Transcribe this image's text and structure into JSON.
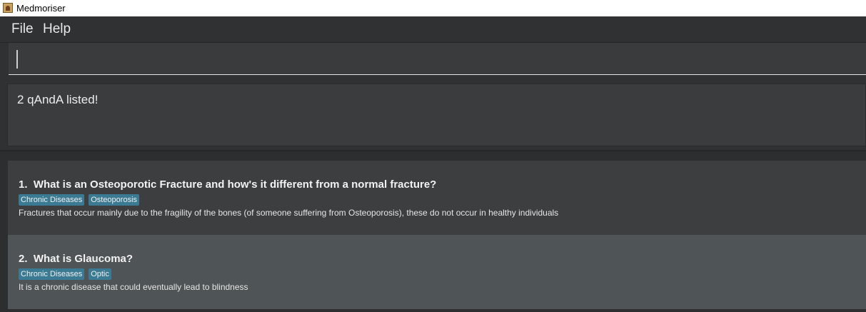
{
  "window": {
    "title": "Medmoriser"
  },
  "menu": {
    "file": "File",
    "help": "Help"
  },
  "command": {
    "value": ""
  },
  "result": {
    "text": "2 qAndA listed!"
  },
  "qanda": [
    {
      "index": "1.",
      "question": "What is an Osteoporotic Fracture and how's it different from a normal fracture?",
      "tags": [
        "Chronic Diseases",
        "Osteoporosis"
      ],
      "answer": "Fractures that occur mainly due to the fragility of the bones (of someone suffering from Osteoporosis), these do not occur in healthy individuals"
    },
    {
      "index": "2.",
      "question": "What is Glaucoma?",
      "tags": [
        "Chronic Diseases",
        "Optic"
      ],
      "answer": "It is a chronic disease that could eventually lead to blindness"
    }
  ],
  "colors": {
    "tag_bg": "#3b7a93",
    "card_selected_bg": "#4f5456",
    "card_bg": "#3c3e40",
    "window_bg": "#3c3f41"
  }
}
